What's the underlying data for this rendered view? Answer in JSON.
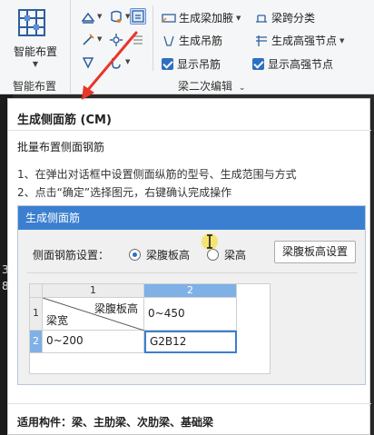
{
  "ribbon": {
    "big_button_label": "智能布置",
    "group1_name": "智能布置",
    "group2_name": "梁二次编辑",
    "items": {
      "beam_haunch": "生成梁加腋",
      "beam_span_classify": "梁跨分类",
      "hanger_bar": "生成吊筋",
      "high_strength_node": "生成高强节点",
      "show_hanger": "显示吊筋",
      "show_high_strength": "显示高强节点"
    }
  },
  "canvas_strip": {
    "text_a": "3",
    "text_b": "8"
  },
  "tooltip": {
    "title": "生成侧面筋 (CM)",
    "subtitle": "批量布置侧面钢筋",
    "step1": "1、在弹出对话框中设置侧面纵筋的型号、生成范围与方式",
    "step2": "2、点击“确定”选择图元，右键确认完成操作",
    "footer": "适用构件：梁、主肋梁、次肋梁、基础梁"
  },
  "dialog": {
    "title": "生成侧面筋",
    "setting_label": "侧面钢筋设置：",
    "radio_web_height": "梁腹板高",
    "radio_beam_height": "梁高",
    "button": "梁腹板高设置",
    "grid": {
      "col_headers": [
        "1",
        "2"
      ],
      "row_headers": [
        "1",
        "2"
      ],
      "diag_top": "梁腹板高",
      "diag_bottom": "梁宽",
      "r1c2": "0~450",
      "r2c1": "0~200",
      "r2c2": "G2B12"
    }
  },
  "colors": {
    "accent": "#3b7fd0",
    "arrow": "#e8362a"
  }
}
